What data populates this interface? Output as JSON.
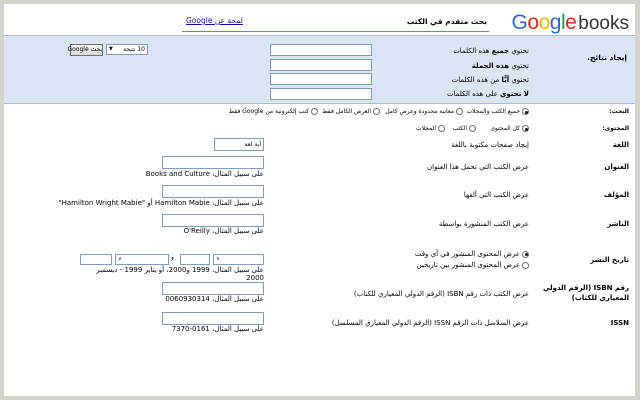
{
  "header": {
    "logo_google": "Google",
    "logo_books": "books",
    "title": "بحث متقدم في الكتب",
    "help_link": "لمحة عن Google"
  },
  "find": {
    "label": "إيجاد نتائج.",
    "rows": [
      {
        "prefix": "تحتوي ",
        "emphasis": "جميع",
        "suffix": " هذه الكلمات"
      },
      {
        "prefix": "تحتوي ",
        "emphasis": "هذه الجملة",
        "suffix": ""
      },
      {
        "prefix": "تحتوي ",
        "emphasis": "أيًّا",
        "suffix": " من هذه الكلمات"
      },
      {
        "prefix": "",
        "emphasis": "لا تحتوي",
        "suffix": " على هذه الكلمات"
      }
    ],
    "results_value": "10 نتيجة",
    "search_button": "بحث Google"
  },
  "search_scope": {
    "label": "البحث:",
    "options": [
      "جميع الكتب والمجلات",
      "معاينة محدودة وعرض كامل",
      "العرض الكامل فقط",
      "كتب إلكترونية من Google فقط"
    ],
    "selected": 0
  },
  "content": {
    "label": "المحتوى:",
    "options": [
      "كل المحتوى",
      "الكتب",
      "المجلات"
    ],
    "selected": 0
  },
  "language": {
    "label": "اللغة",
    "desc": "إيجاد صفحات مكتوبة باللغة",
    "value": "أية لغة"
  },
  "title_field": {
    "label": "العنوان",
    "desc": "عرض الكتب التي تحمل هذا العنوان",
    "example": "على سبيل المثال، Books and Culture"
  },
  "author": {
    "label": "المؤلف",
    "desc": "عرض الكتب التي ألفها",
    "example_line1": "على سبيل المثال، Hamilton Mabie أو \"Hamilton Wright Mabie\"",
    "example_line2": "\"Hamilton Wright Mabie\""
  },
  "publisher": {
    "label": "الناشر",
    "desc": "عرض الكتب المنشورة بواسطة",
    "example": "على سبيل المثال، O'Reilly"
  },
  "pub_date": {
    "label": "تاريخ النشر",
    "options": [
      "عرض المحتوى المنشور في أي وقت",
      "عرض المحتوى المنشور بين تاريخين"
    ],
    "selected": 0,
    "between": "و",
    "example_line1": "على سبيل المثال، 1999 و2000، أو يناير 1999 - ديسمبر",
    "example_line2": "2000"
  },
  "isbn": {
    "label": "رقم ISBN (الرقم الدولي المعياري للكتاب)",
    "desc": "عرض الكتب ذات رقم ISBN (الرقم الدولي المعياري للكتاب)",
    "example": "على سبيل المثال، 0060930314"
  },
  "issn": {
    "label": "ISSN",
    "desc": "عرض السلاسل ذات الرقم ISSN (الرقم الدولي المعياري المسلسل)",
    "example": "على سبيل المثال، 0161-7370"
  }
}
